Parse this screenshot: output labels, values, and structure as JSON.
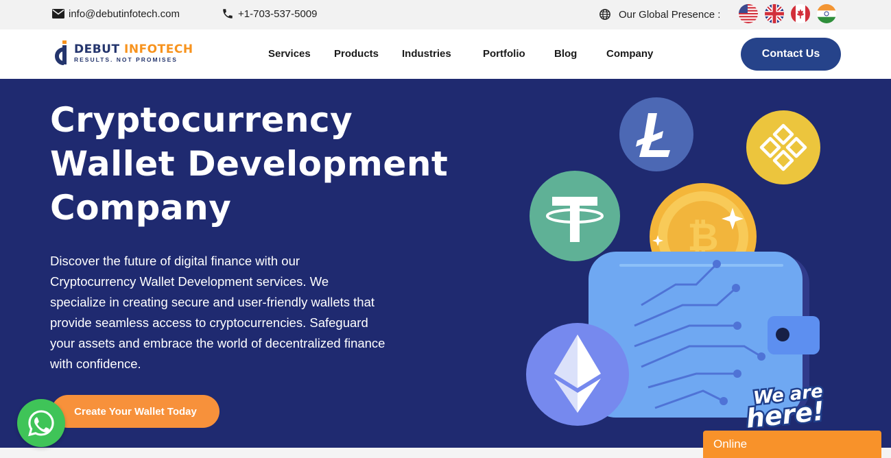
{
  "topbar": {
    "email": "info@debutinfotech.com",
    "phone": "+1-703-537-5009",
    "global_label": "Our Global Presence :",
    "flags": [
      "us-flag-icon",
      "uk-flag-icon",
      "canada-flag-icon",
      "india-flag-icon"
    ]
  },
  "header": {
    "logo_part1": "DEBUT",
    "logo_part2": "INFOTECH",
    "logo_tagline": "RESULTS. NOT PROMISES",
    "nav": [
      "Services",
      "Products",
      "Industries",
      "Portfolio",
      "Blog",
      "Company"
    ],
    "contact_label": "Contact Us"
  },
  "hero": {
    "title_lines": [
      "Cryptocurrency",
      "Wallet Development",
      "Company"
    ],
    "description": "Discover the future of digital finance with our Cryptocurrency Wallet Development services. We specialize in creating secure and user-friendly wallets that provide seamless access to cryptocurrencies. Safeguard your assets and embrace the world of decentralized finance with confidence.",
    "cta_label": "Create Your Wallet Today",
    "illustration_icons": [
      "litecoin-icon",
      "binance-icon",
      "tether-icon",
      "bitcoin-icon",
      "ethereum-icon",
      "wallet-icon"
    ]
  },
  "chat": {
    "bubble_text": "We are here!",
    "status": "Online"
  },
  "colors": {
    "hero_bg": "#1f2a70",
    "accent_orange": "#f7913b",
    "button_navy": "#26438a",
    "whatsapp_green": "#3fc458"
  }
}
